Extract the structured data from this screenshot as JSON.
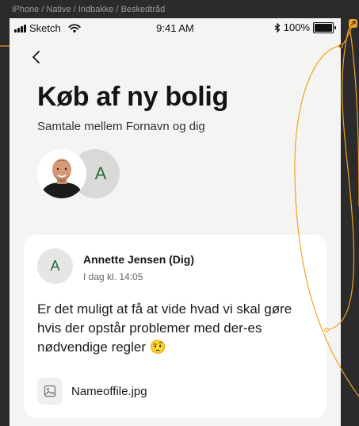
{
  "artboard": {
    "label": "iPhone / Native / Indbakke / Beskedtråd"
  },
  "status_bar": {
    "carrier": "Sketch",
    "time": "9:41 AM",
    "battery": "100%",
    "battery_level": 1.0
  },
  "header": {
    "back_icon": "chevron-left-icon",
    "title": "Køb af ny bolig",
    "subtitle": "Samtale mellem Fornavn og dig"
  },
  "participants": {
    "second_initial": "A"
  },
  "message": {
    "avatar_initial": "A",
    "author": "Annette Jensen (Dig)",
    "timestamp": "I dag kl. 14:05",
    "body": "Er det muligt at få at vide hvad vi skal gøre hvis der opstår problemer med der-es nødvendige regler",
    "emoji": "🤨",
    "attachment": {
      "icon": "image-icon",
      "filename": "Nameoffile.jpg"
    }
  },
  "colors": {
    "background": "#2b2b2b",
    "screen": "#f4f4f2",
    "card": "#ffffff",
    "initial_text": "#2f6b3a",
    "prototype_link": "#f0a224"
  }
}
